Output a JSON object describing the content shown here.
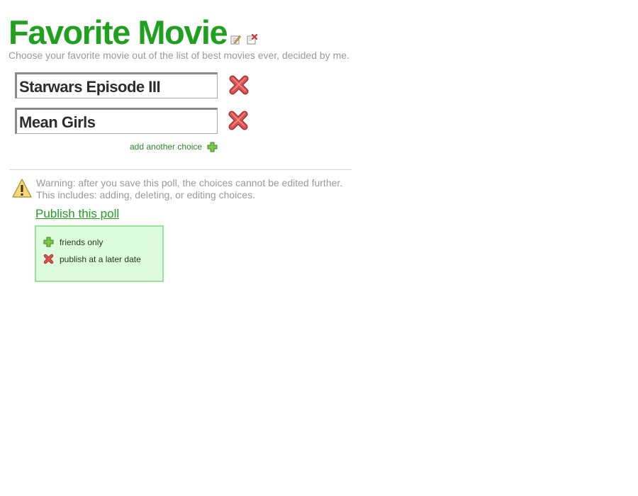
{
  "header": {
    "title": "Favorite Movie",
    "subtitle": "Choose your favorite movie out of the list of best movies ever, decided by me.",
    "icons": [
      "edit-icon",
      "delete-poll-icon"
    ]
  },
  "choices": [
    {
      "value": "Starwars Episode III",
      "delete_icon": "red-x-icon"
    },
    {
      "value": "Mean Girls",
      "delete_icon": "red-x-icon"
    }
  ],
  "add_choice": {
    "label": "add another choice",
    "icon": "green-plus-icon"
  },
  "warning": {
    "icon": "warning-triangle-icon",
    "line1": "Warning: after you save this poll, the choices cannot be edited further.",
    "line2": "This includes: adding, deleting, or editing choices."
  },
  "publish": {
    "label": "Publish this poll"
  },
  "options": [
    {
      "label": "friends only",
      "icon": "green-plus-icon"
    },
    {
      "label": "publish at a later date",
      "icon": "red-x-icon"
    }
  ],
  "colors": {
    "title": "#1fa01f",
    "subtitle": "#9a9a9a",
    "options_bg": "#ddfcdd",
    "options_border": "#9be09b",
    "delete_red": "#d94545"
  }
}
